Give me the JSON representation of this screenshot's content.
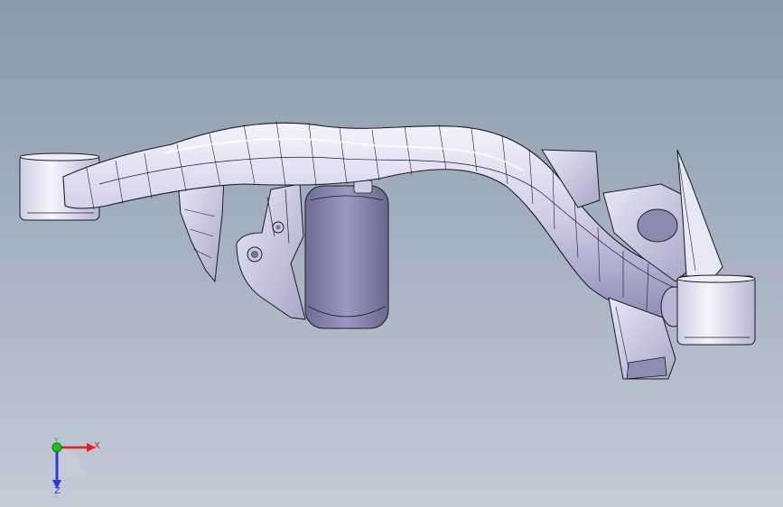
{
  "viewport": {
    "background_top": "#8b9aac",
    "background_bottom": "#c3cbd6"
  },
  "model": {
    "icon": "cad-subframe-model",
    "part_fill": "#d6d4ec",
    "part_shadow": "#8f8cb2",
    "edge_color": "#1c1c24"
  },
  "triad": {
    "x_label": "X",
    "y_label": "Y",
    "z_label": "Z",
    "x_color": "#e02020",
    "y_color": "#1fbf2a",
    "z_color": "#2a3bd8"
  }
}
